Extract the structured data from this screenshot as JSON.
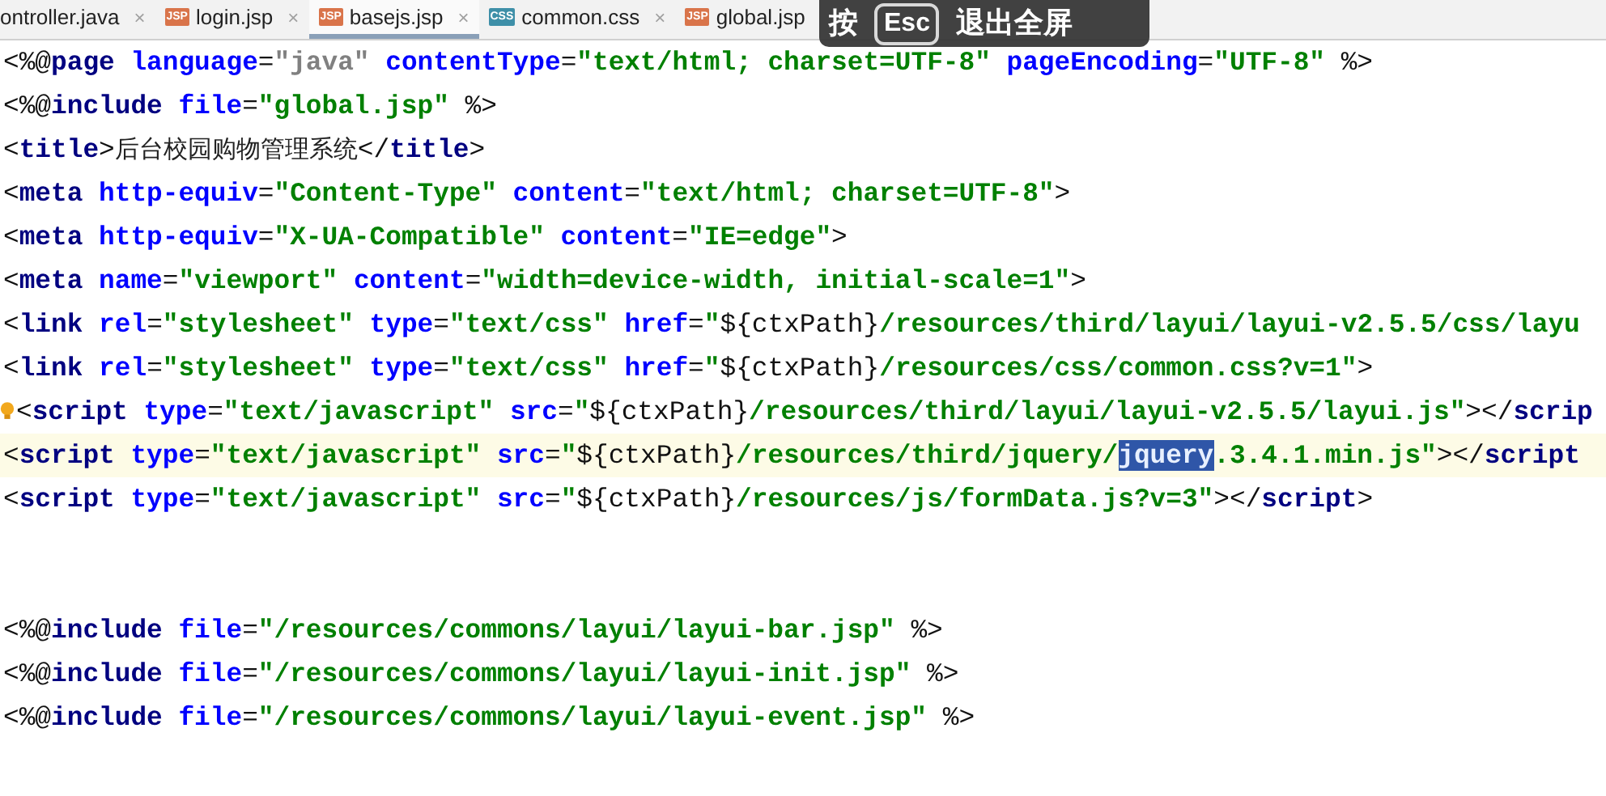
{
  "tabs": [
    {
      "label": "ontroller.java",
      "close": "×",
      "selected": false
    },
    {
      "label": "login.jsp",
      "icon": {
        "label": "JSP",
        "color": "#d9744a"
      },
      "close": "×",
      "selected": false
    },
    {
      "label": "basejs.jsp",
      "icon": {
        "label": "JSP",
        "color": "#d9744a"
      },
      "close": "×",
      "selected": true
    },
    {
      "label": "common.css",
      "icon": {
        "label": "CSS",
        "color": "#3e8fa8"
      },
      "close": "×",
      "selected": false
    },
    {
      "label": "global.jsp",
      "icon": {
        "label": "JSP",
        "color": "#d9744a"
      },
      "selected": false
    }
  ],
  "overlay": {
    "before": "按",
    "key": "Esc",
    "after": "退出全屏"
  },
  "editor": {
    "blocks": [
      {
        "lines": [
          {
            "current": false,
            "bulb": false,
            "tokens": [
              {
                "kind": "p",
                "text": "<%@"
              },
              {
                "kind": "t",
                "text": "page"
              },
              {
                "kind": "a",
                "text": " language"
              },
              {
                "kind": "p",
                "text": "="
              },
              {
                "kind": "g",
                "text": "\"java\""
              },
              {
                "kind": "a",
                "text": " contentType"
              },
              {
                "kind": "p",
                "text": "="
              },
              {
                "kind": "s",
                "text": "\"text/html; charset=UTF-8\""
              },
              {
                "kind": "a",
                "text": " pageEncoding"
              },
              {
                "kind": "p",
                "text": "="
              },
              {
                "kind": "s",
                "text": "\"UTF-8\""
              },
              {
                "kind": "p",
                "text": " %>"
              }
            ]
          },
          {
            "current": false,
            "bulb": false,
            "tokens": [
              {
                "kind": "p",
                "text": "<%@"
              },
              {
                "kind": "t",
                "text": "include"
              },
              {
                "kind": "a",
                "text": " file"
              },
              {
                "kind": "p",
                "text": "="
              },
              {
                "kind": "s",
                "text": "\"global.jsp\""
              },
              {
                "kind": "p",
                "text": " %>"
              }
            ]
          },
          {
            "current": false,
            "bulb": false,
            "tokens": [
              {
                "kind": "p",
                "text": "<"
              },
              {
                "kind": "t",
                "text": "title"
              },
              {
                "kind": "p",
                "text": ">"
              },
              {
                "kind": "c",
                "text": "后台校园购物管理系统"
              },
              {
                "kind": "p",
                "text": "</"
              },
              {
                "kind": "t",
                "text": "title"
              },
              {
                "kind": "p",
                "text": ">"
              }
            ]
          },
          {
            "current": false,
            "bulb": false,
            "tokens": [
              {
                "kind": "p",
                "text": "<"
              },
              {
                "kind": "t",
                "text": "meta"
              },
              {
                "kind": "a",
                "text": " http-equiv"
              },
              {
                "kind": "p",
                "text": "="
              },
              {
                "kind": "s",
                "text": "\"Content-Type\""
              },
              {
                "kind": "a",
                "text": " content"
              },
              {
                "kind": "p",
                "text": "="
              },
              {
                "kind": "s",
                "text": "\"text/html; charset=UTF-8\""
              },
              {
                "kind": "p",
                "text": ">"
              }
            ]
          },
          {
            "current": false,
            "bulb": false,
            "tokens": [
              {
                "kind": "p",
                "text": "<"
              },
              {
                "kind": "t",
                "text": "meta"
              },
              {
                "kind": "a",
                "text": " http-equiv"
              },
              {
                "kind": "p",
                "text": "="
              },
              {
                "kind": "s",
                "text": "\"X-UA-Compatible\""
              },
              {
                "kind": "a",
                "text": " content"
              },
              {
                "kind": "p",
                "text": "="
              },
              {
                "kind": "s",
                "text": "\"IE=edge\""
              },
              {
                "kind": "p",
                "text": ">"
              }
            ]
          },
          {
            "current": false,
            "bulb": false,
            "tokens": [
              {
                "kind": "p",
                "text": "<"
              },
              {
                "kind": "t",
                "text": "meta"
              },
              {
                "kind": "a",
                "text": " name"
              },
              {
                "kind": "p",
                "text": "="
              },
              {
                "kind": "s",
                "text": "\"viewport\""
              },
              {
                "kind": "a",
                "text": " content"
              },
              {
                "kind": "p",
                "text": "="
              },
              {
                "kind": "s",
                "text": "\"width=device-width, initial-scale=1\""
              },
              {
                "kind": "p",
                "text": ">"
              }
            ]
          },
          {
            "current": false,
            "bulb": false,
            "tokens": [
              {
                "kind": "p",
                "text": "<"
              },
              {
                "kind": "t",
                "text": "link"
              },
              {
                "kind": "a",
                "text": " rel"
              },
              {
                "kind": "p",
                "text": "="
              },
              {
                "kind": "s",
                "text": "\"stylesheet\""
              },
              {
                "kind": "a",
                "text": " type"
              },
              {
                "kind": "p",
                "text": "="
              },
              {
                "kind": "s",
                "text": "\"text/css\""
              },
              {
                "kind": "a",
                "text": " href"
              },
              {
                "kind": "p",
                "text": "="
              },
              {
                "kind": "s",
                "text": "\""
              },
              {
                "kind": "e",
                "text": "${ctxPath}"
              },
              {
                "kind": "s",
                "text": "/resources/third/layui/layui-v2.5.5/css/layu"
              }
            ]
          },
          {
            "current": false,
            "bulb": false,
            "tokens": [
              {
                "kind": "p",
                "text": "<"
              },
              {
                "kind": "t",
                "text": "link"
              },
              {
                "kind": "a",
                "text": " rel"
              },
              {
                "kind": "p",
                "text": "="
              },
              {
                "kind": "s",
                "text": "\"stylesheet\""
              },
              {
                "kind": "a",
                "text": " type"
              },
              {
                "kind": "p",
                "text": "="
              },
              {
                "kind": "s",
                "text": "\"text/css\""
              },
              {
                "kind": "a",
                "text": " href"
              },
              {
                "kind": "p",
                "text": "="
              },
              {
                "kind": "s",
                "text": "\""
              },
              {
                "kind": "e",
                "text": "${ctxPath}"
              },
              {
                "kind": "s",
                "text": "/resources/css/common.css?v=1\""
              },
              {
                "kind": "p",
                "text": ">"
              }
            ]
          },
          {
            "current": false,
            "bulb": true,
            "tokens": [
              {
                "kind": "p",
                "text": "<"
              },
              {
                "kind": "t",
                "text": "script"
              },
              {
                "kind": "a",
                "text": " type"
              },
              {
                "kind": "p",
                "text": "="
              },
              {
                "kind": "s",
                "text": "\"text/javascript\""
              },
              {
                "kind": "a",
                "text": " src"
              },
              {
                "kind": "p",
                "text": "="
              },
              {
                "kind": "s",
                "text": "\""
              },
              {
                "kind": "e",
                "text": "${ctxPath}"
              },
              {
                "kind": "s",
                "text": "/resources/third/layui/layui-v2.5.5/layui.js\""
              },
              {
                "kind": "p",
                "text": "></"
              },
              {
                "kind": "t",
                "text": "scrip"
              }
            ]
          },
          {
            "current": true,
            "bulb": false,
            "tokens": [
              {
                "kind": "p",
                "text": "<"
              },
              {
                "kind": "t",
                "text": "script"
              },
              {
                "kind": "a",
                "text": " type"
              },
              {
                "kind": "p",
                "text": "="
              },
              {
                "kind": "s",
                "text": "\"text/javascript\""
              },
              {
                "kind": "a",
                "text": " src"
              },
              {
                "kind": "p",
                "text": "="
              },
              {
                "kind": "s",
                "text": "\""
              },
              {
                "kind": "e",
                "text": "${ctxPath}"
              },
              {
                "kind": "s",
                "text": "/resources/third/jquery/"
              },
              {
                "kind": "sel",
                "text": "jquery"
              },
              {
                "kind": "s",
                "text": ".3.4.1.min.js\""
              },
              {
                "kind": "p",
                "text": "></"
              },
              {
                "kind": "t",
                "text": "script"
              }
            ]
          },
          {
            "current": false,
            "bulb": false,
            "tokens": [
              {
                "kind": "p",
                "text": "<"
              },
              {
                "kind": "t",
                "text": "script"
              },
              {
                "kind": "a",
                "text": " type"
              },
              {
                "kind": "p",
                "text": "="
              },
              {
                "kind": "s",
                "text": "\"text/javascript\""
              },
              {
                "kind": "a",
                "text": " src"
              },
              {
                "kind": "p",
                "text": "="
              },
              {
                "kind": "s",
                "text": "\""
              },
              {
                "kind": "e",
                "text": "${ctxPath}"
              },
              {
                "kind": "s",
                "text": "/resources/js/formData.js?v=3\""
              },
              {
                "kind": "p",
                "text": "></"
              },
              {
                "kind": "t",
                "text": "script"
              },
              {
                "kind": "p",
                "text": ">"
              }
            ]
          }
        ]
      },
      {
        "lines": [
          {
            "current": false,
            "bulb": false,
            "tokens": [
              {
                "kind": "p",
                "text": "<%@"
              },
              {
                "kind": "t",
                "text": "include"
              },
              {
                "kind": "a",
                "text": " file"
              },
              {
                "kind": "p",
                "text": "="
              },
              {
                "kind": "s",
                "text": "\"/resources/commons/layui/layui-bar.jsp\""
              },
              {
                "kind": "p",
                "text": " %>"
              }
            ]
          },
          {
            "current": false,
            "bulb": false,
            "tokens": [
              {
                "kind": "p",
                "text": "<%@"
              },
              {
                "kind": "t",
                "text": "include"
              },
              {
                "kind": "a",
                "text": " file"
              },
              {
                "kind": "p",
                "text": "="
              },
              {
                "kind": "s",
                "text": "\"/resources/commons/layui/layui-init.jsp\""
              },
              {
                "kind": "p",
                "text": " %>"
              }
            ]
          },
          {
            "current": false,
            "bulb": false,
            "tokens": [
              {
                "kind": "p",
                "text": "<%@"
              },
              {
                "kind": "t",
                "text": "include"
              },
              {
                "kind": "a",
                "text": " file"
              },
              {
                "kind": "p",
                "text": "="
              },
              {
                "kind": "s",
                "text": "\"/resources/commons/layui/layui-event.jsp\""
              },
              {
                "kind": "p",
                "text": " %>"
              }
            ]
          }
        ]
      }
    ]
  }
}
